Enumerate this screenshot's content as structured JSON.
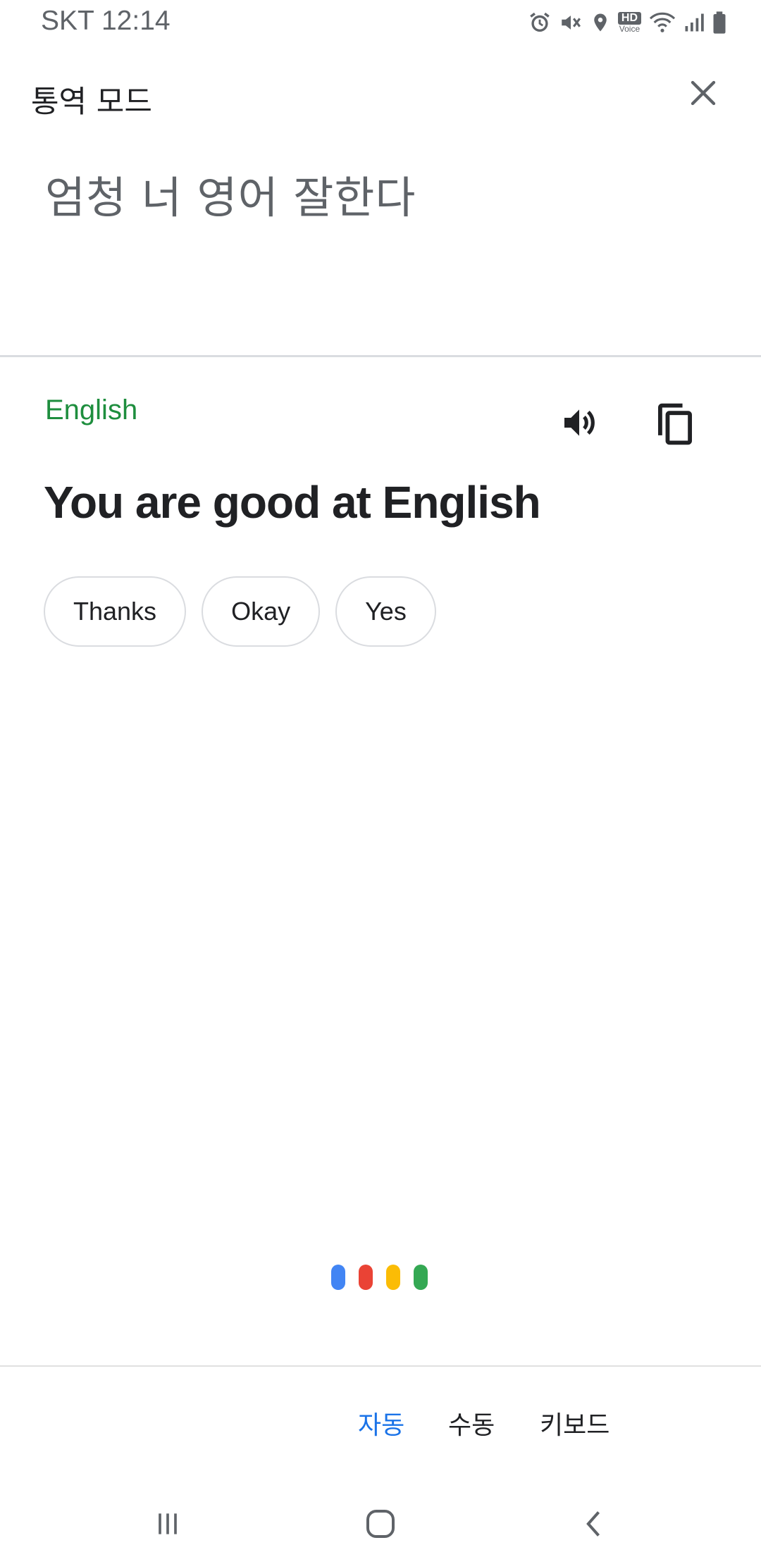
{
  "status_bar": {
    "carrier_time": "SKT 12:14",
    "hd_label": "HD",
    "voice_label": "Voice",
    "icons": [
      "alarm-icon",
      "mute-icon",
      "location-icon",
      "hd-voice-icon",
      "wifi-icon",
      "signal-icon",
      "battery-icon"
    ]
  },
  "header": {
    "title": "통역 모드",
    "close_icon": "close-icon"
  },
  "source": {
    "text": "엄청 너 영어 잘한다"
  },
  "translation": {
    "language": "English",
    "text": "You are good at English",
    "speaker_icon": "speaker-icon",
    "copy_icon": "copy-icon"
  },
  "quick_replies": [
    "Thanks",
    "Okay",
    "Yes"
  ],
  "voice_indicator": {
    "colors": [
      "#4285f4",
      "#ea4335",
      "#fbbc05",
      "#34a853"
    ]
  },
  "modes": {
    "auto": "자동",
    "manual": "수동",
    "keyboard": "키보드",
    "selected": "auto"
  },
  "nav": [
    "recents-icon",
    "home-icon",
    "back-icon"
  ],
  "colors": {
    "accent_blue": "#1a73e8",
    "language_green": "#1e8e3e"
  }
}
